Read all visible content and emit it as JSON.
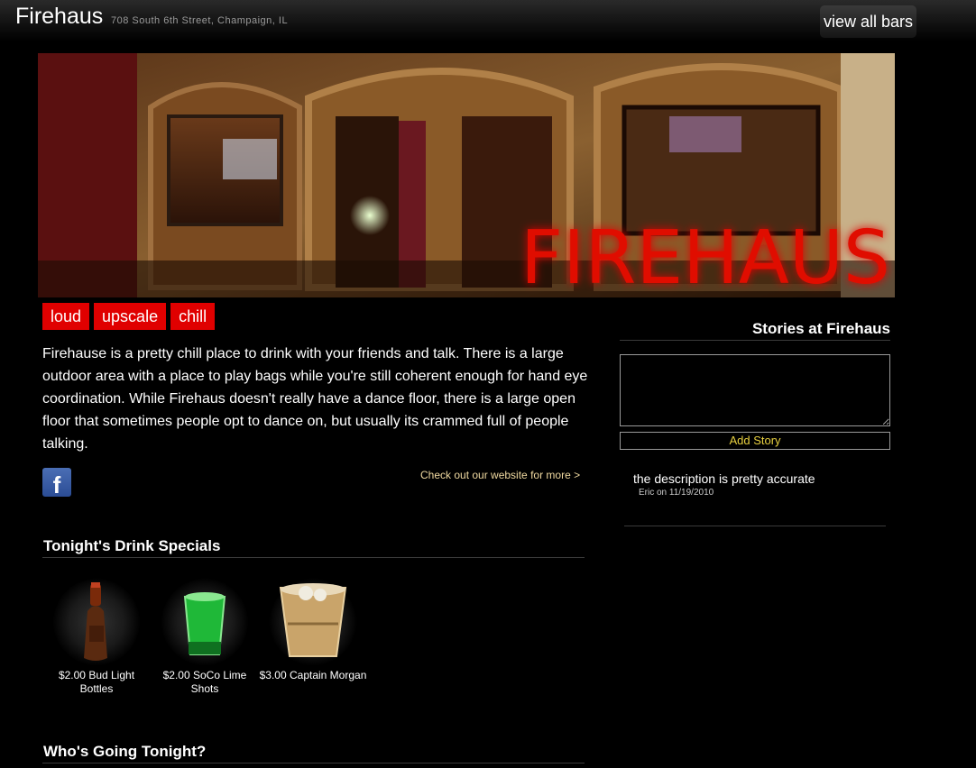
{
  "header": {
    "bar_name": "Firehaus",
    "address": "708 South 6th Street, Champaign, IL",
    "view_all_label": "view all bars"
  },
  "hero": {
    "sign_text": "FIREHAUS"
  },
  "tags": [
    "loud",
    "upscale",
    "chill"
  ],
  "description": "Firehause is a pretty chill place to drink with your friends and talk. There is a large outdoor area with a place to play bags while you're still coherent enough for hand eye coordination. While Firehaus doesn't really have a dance floor, there is a large open floor that sometimes people opt to dance on, but usually its crammed full of people talking.",
  "social": {
    "facebook_glyph": "f",
    "website_link": "Check out our website for more >"
  },
  "specials": {
    "title": "Tonight's Drink Specials",
    "items": [
      {
        "caption": "$2.00 Bud Light Bottles",
        "icon": "beer-bottle-icon"
      },
      {
        "caption": "$2.00 SoCo Lime Shots",
        "icon": "shot-glass-icon"
      },
      {
        "caption": "$3.00 Captain Morgan",
        "icon": "cup-icon"
      }
    ]
  },
  "going": {
    "title": "Who's Going Tonight?"
  },
  "stories": {
    "title": "Stories at Firehaus",
    "input_value": "",
    "add_label": "Add Story",
    "items": [
      {
        "text": "the description is pretty accurate",
        "meta": "Eric on 11/19/2010"
      }
    ]
  },
  "colors": {
    "tag_red": "#e00000",
    "link_gold": "#f0d9a0",
    "add_story_yellow": "#e8d040",
    "sign_red": "#e01000"
  }
}
